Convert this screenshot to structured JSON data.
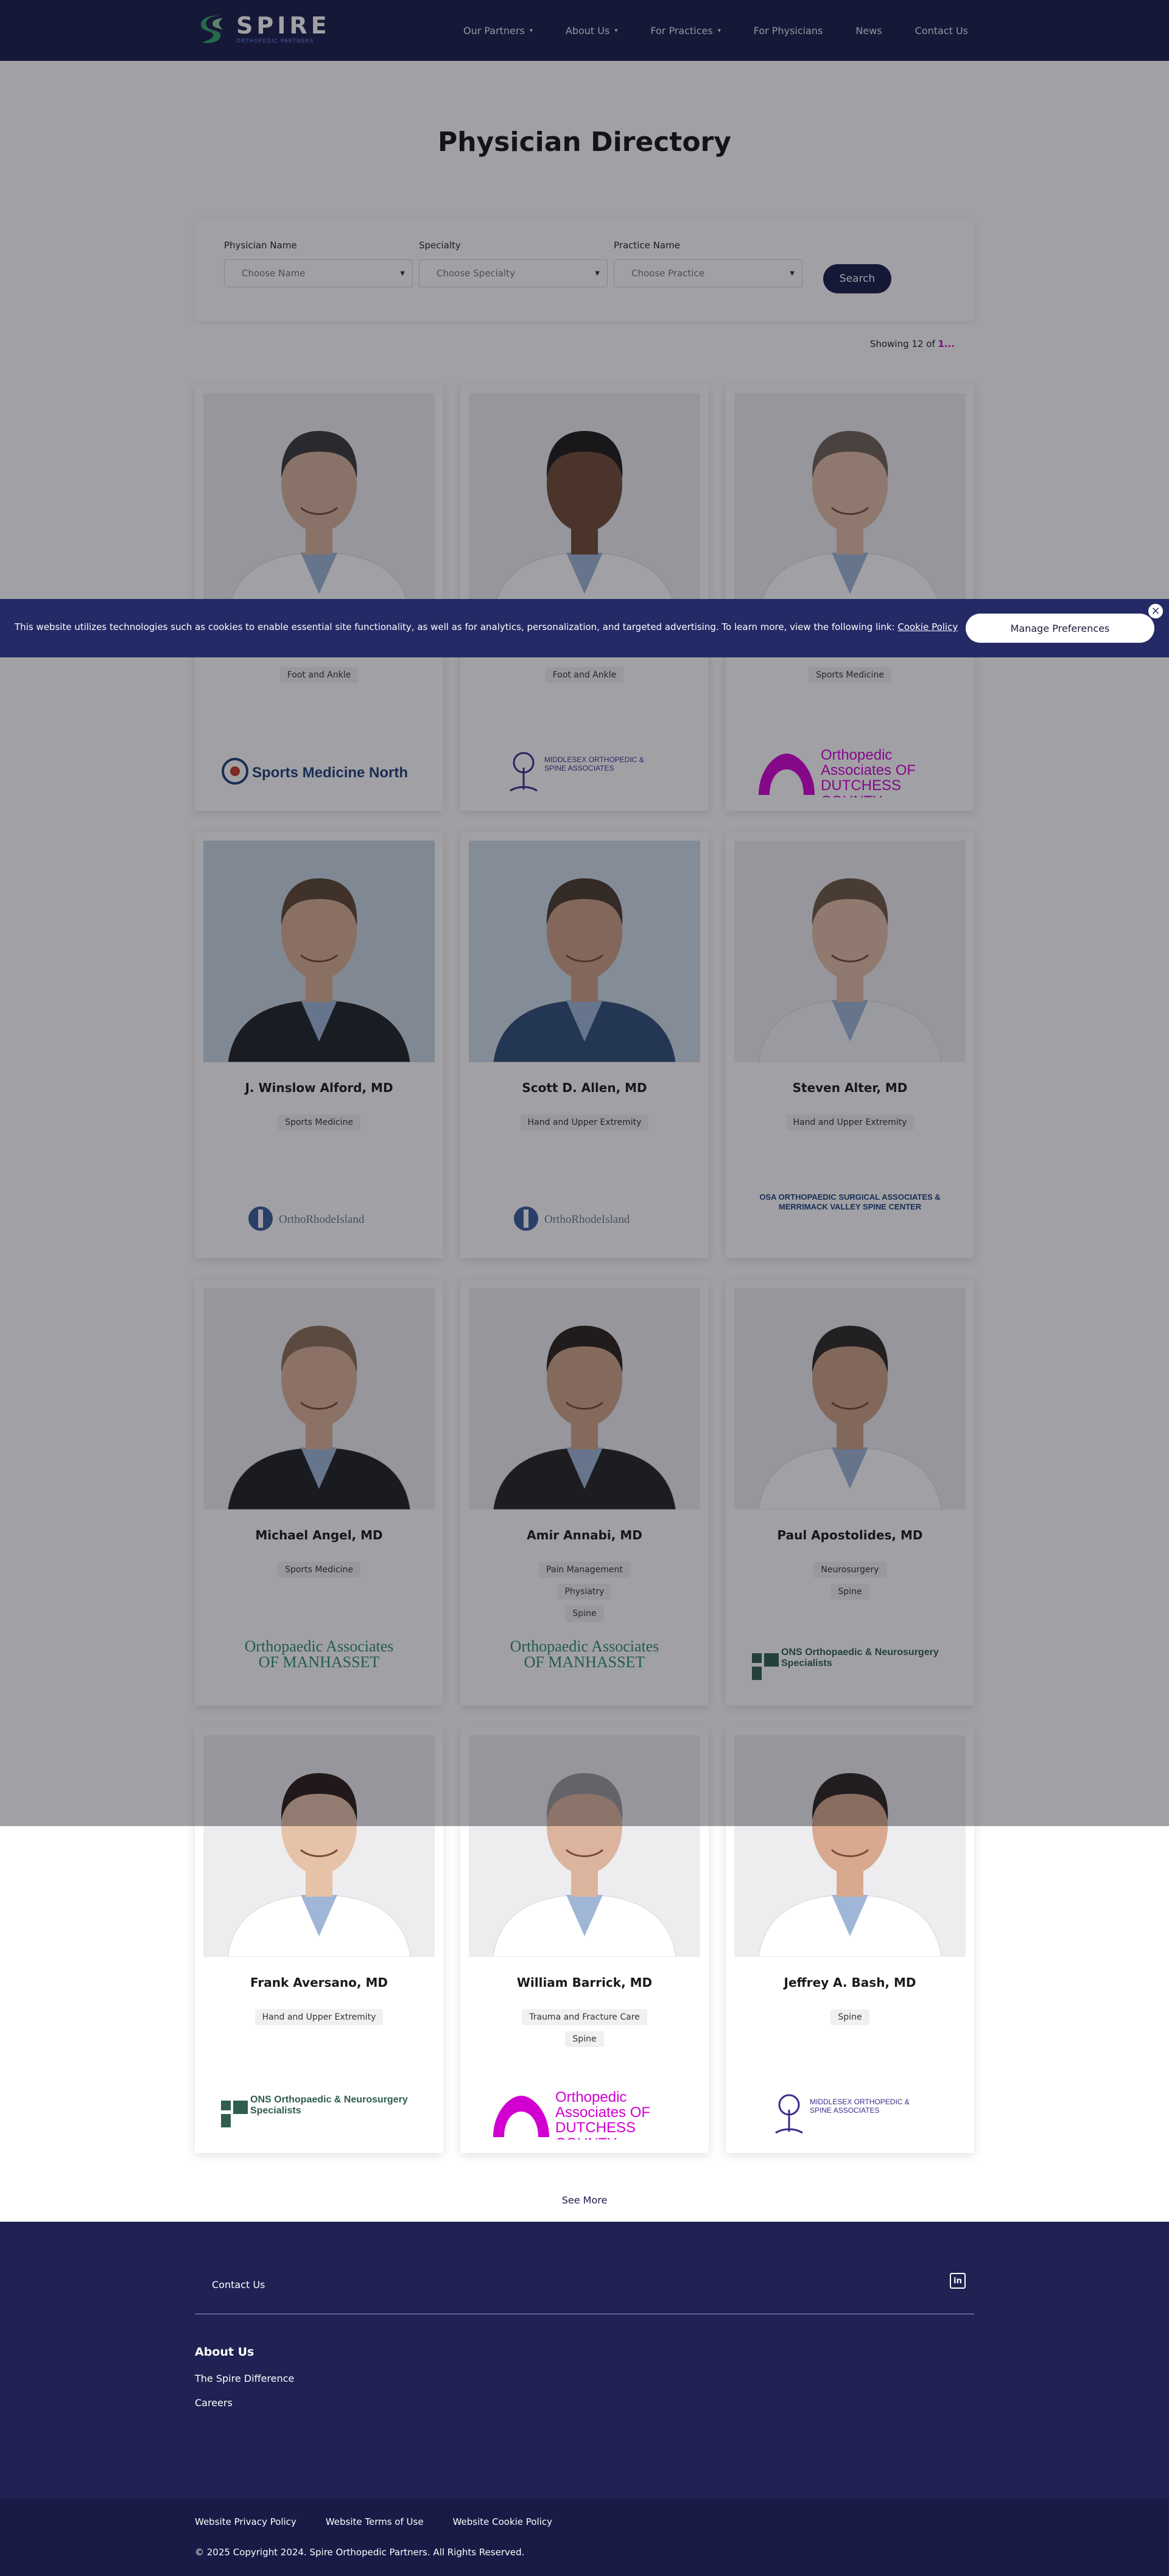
{
  "header": {
    "logo_text": "SPIRE",
    "logo_subtext": "ORTHOPEDIC PARTNERS",
    "nav": [
      {
        "label": "Our Partners",
        "dropdown": true
      },
      {
        "label": "About Us",
        "dropdown": true
      },
      {
        "label": "For Practices",
        "dropdown": true
      },
      {
        "label": "For Physicians",
        "dropdown": false
      },
      {
        "label": "News",
        "dropdown": false
      },
      {
        "label": "Contact Us",
        "dropdown": false
      }
    ]
  },
  "page_title": "Physician Directory",
  "filters": {
    "name_label": "Physician Name",
    "name_placeholder": "Choose Name",
    "specialty_label": "Specialty",
    "specialty_placeholder": "Choose Specialty",
    "practice_label": "Practice Name",
    "practice_placeholder": "Choose Practice",
    "search_label": "Search"
  },
  "showing": {
    "prefix": "Showing 12 of ",
    "highlight": "1..."
  },
  "physicians": [
    {
      "name": "",
      "tags": [
        "Foot and Ankle"
      ],
      "practice": "Sports Medicine North",
      "logo": "smn"
    },
    {
      "name": "",
      "tags": [
        "Foot and Ankle"
      ],
      "practice": "MIDDLESEX ORTHOPEDIC & SPINE ASSOCIATES",
      "logo": "middlesex"
    },
    {
      "name": "",
      "tags": [
        "Sports Medicine"
      ],
      "practice": "Orthopedic Associates OF DUTCHESS COUNTY",
      "logo": "oadc"
    },
    {
      "name": "J. Winslow Alford, MD",
      "tags": [
        "Sports Medicine"
      ],
      "practice": "OrthoRhodeIsland",
      "logo": "ori"
    },
    {
      "name": "Scott D. Allen, MD",
      "tags": [
        "Hand and Upper Extremity"
      ],
      "practice": "OrthoRhodeIsland",
      "logo": "ori"
    },
    {
      "name": "Steven Alter, MD",
      "tags": [
        "Hand and Upper Extremity"
      ],
      "practice": "OSA ORTHOPAEDIC SURGICAL ASSOCIATES & MERRIMACK VALLEY SPINE CENTER",
      "logo": "osa"
    },
    {
      "name": "Michael Angel, MD",
      "tags": [
        "Sports Medicine"
      ],
      "practice": "Orthopaedic Associates OF MANHASSET",
      "logo": "oam"
    },
    {
      "name": "Amir Annabi, MD",
      "tags": [
        "Pain Management",
        "Physiatry",
        "Spine"
      ],
      "practice": "Orthopaedic Associates OF MANHASSET",
      "logo": "oam"
    },
    {
      "name": "Paul Apostolides, MD",
      "tags": [
        "Neurosurgery",
        "Spine"
      ],
      "practice": "ONS Orthopaedic & Neurosurgery Specialists",
      "logo": "ons"
    },
    {
      "name": "Frank Aversano, MD",
      "tags": [
        "Hand and Upper Extremity"
      ],
      "practice": "ONS Orthopaedic & Neurosurgery Specialists",
      "logo": "ons"
    },
    {
      "name": "William Barrick, MD",
      "tags": [
        "Trauma and Fracture Care",
        "Spine"
      ],
      "practice": "Orthopedic Associates OF DUTCHESS COUNTY",
      "logo": "oadc"
    },
    {
      "name": "Jeffrey A. Bash, MD",
      "tags": [
        "Spine"
      ],
      "practice": "MIDDLESEX ORTHOPEDIC & SPINE ASSOCIATES",
      "logo": "middlesex"
    }
  ],
  "cookie_banner": {
    "text": "This website utilizes technologies such as cookies to enable essential site functionality, as well as for analytics, personalization, and targeted advertising. To learn more, view the following link: ",
    "link": "Cookie Policy",
    "button": "Manage Preferences",
    "close_icon": "close-icon"
  },
  "see_more": "See More",
  "footer": {
    "contact": "Contact Us",
    "social_icon": "linkedin-icon",
    "about_heading": "About Us",
    "about_links": [
      "The Spire Difference",
      "Careers"
    ],
    "bottom_links": [
      "Website Privacy Policy",
      "Website Terms of Use",
      "Website Cookie Policy"
    ],
    "copyright": "© 2025 Copyright 2024. Spire Orthopedic Partners. All Rights Reserved."
  },
  "colors": {
    "navy": "#181c4a",
    "cookie_bg": "#242a66",
    "footer_bg": "#1f2252",
    "magenta": "#d100d1",
    "ons_green": "#2f5d50",
    "oam_green": "#2e8a6e",
    "ori_blue": "#3a5c9a"
  }
}
